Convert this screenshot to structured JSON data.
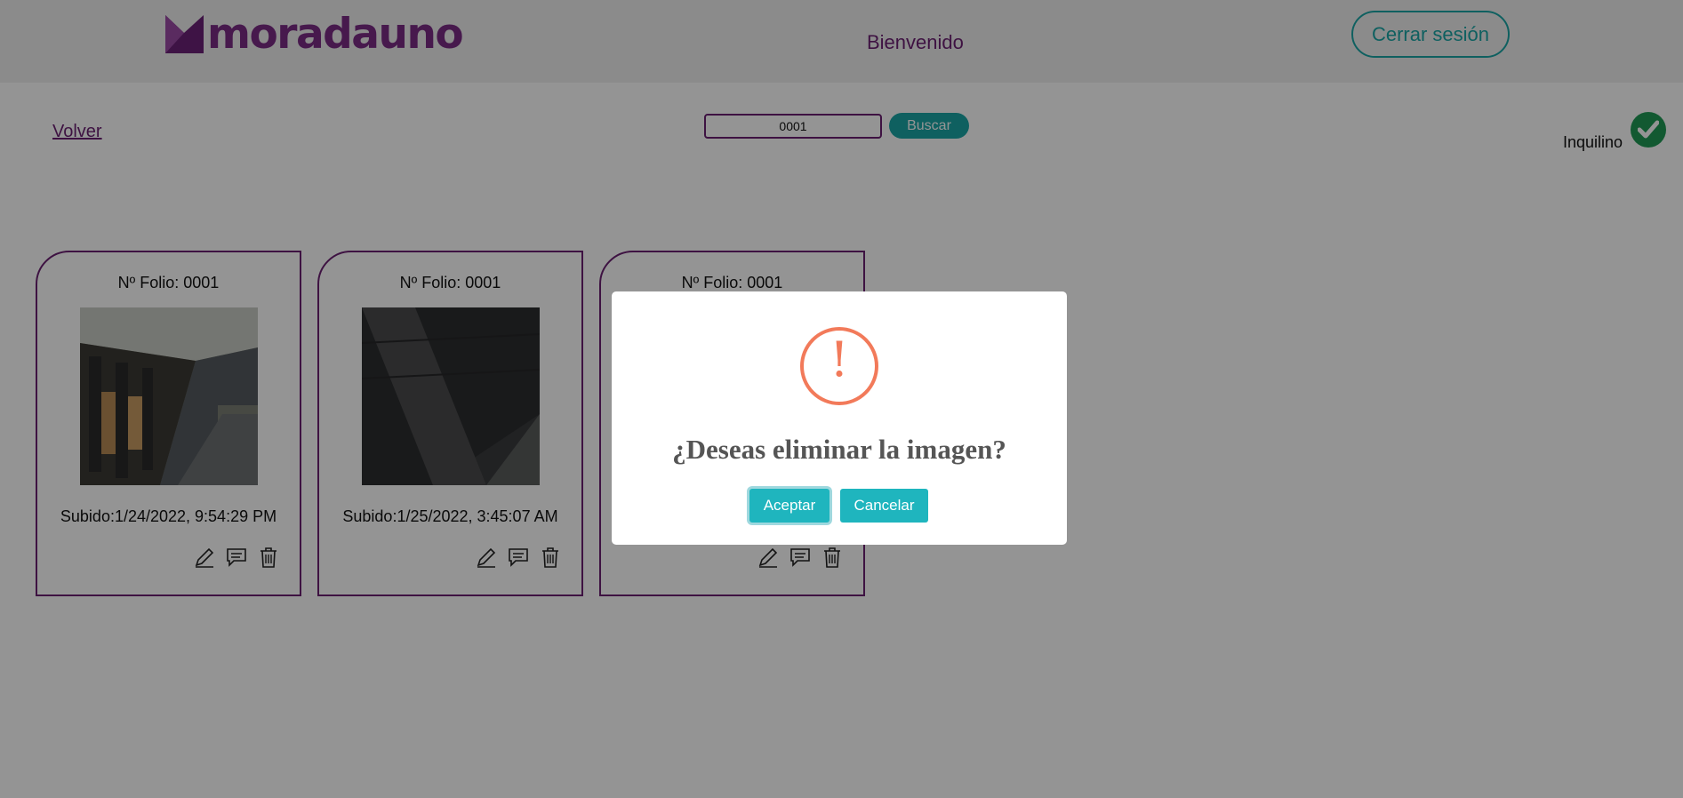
{
  "header": {
    "brand": "moradauno",
    "welcome": "Bienvenido",
    "logout_label": "Cerrar sesión",
    "brand_color": "#7a2b86",
    "accent_color": "#1aa6a6"
  },
  "toolbar": {
    "back_label": "Volver",
    "search_value": "0001",
    "search_button": "Buscar",
    "role_label": "Inquilino",
    "role_icon": "check-circle-icon"
  },
  "cards": [
    {
      "folio": "Nº Folio: 0001",
      "uploaded": "Subido:1/24/2022, 9:54:29 PM",
      "actions": [
        "edit-icon",
        "comment-icon",
        "trash-icon"
      ]
    },
    {
      "folio": "Nº Folio: 0001",
      "uploaded": "Subido:1/25/2022, 3:45:07 AM",
      "actions": [
        "edit-icon",
        "comment-icon",
        "trash-icon"
      ]
    },
    {
      "folio": "Nº Folio: 0001",
      "uploaded": "",
      "actions": [
        "edit-icon",
        "comment-icon",
        "trash-icon"
      ]
    }
  ],
  "modal": {
    "icon": "warning-icon",
    "icon_glyph": "!",
    "title": "¿Deseas eliminar la imagen?",
    "accept_label": "Aceptar",
    "cancel_label": "Cancelar",
    "warning_color": "#f27a5a",
    "button_color": "#1fb5be"
  }
}
